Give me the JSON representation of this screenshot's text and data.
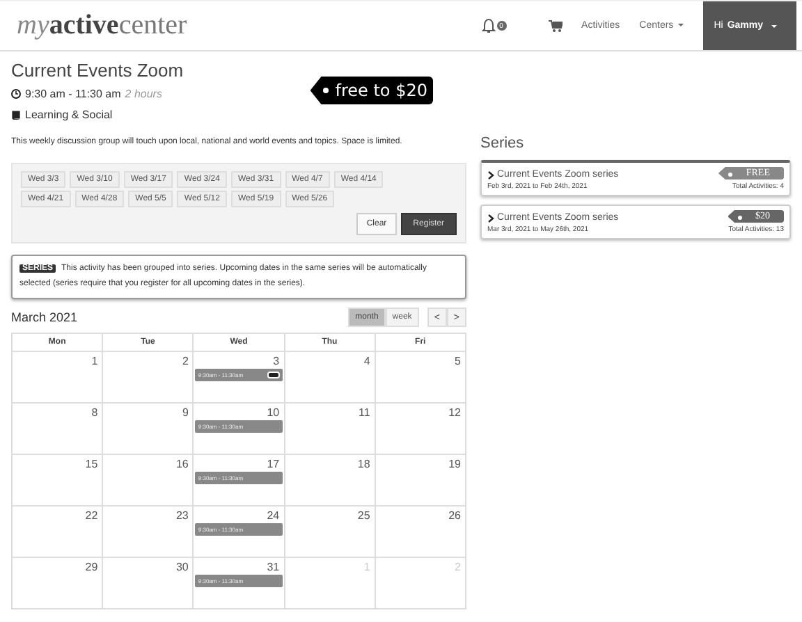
{
  "navbar": {
    "logo": {
      "script": "my",
      "bold": "active",
      "light": "center"
    },
    "notification_count": "0",
    "links": [
      "Activities",
      "Centers"
    ],
    "user": {
      "greeting": "Hi",
      "name": "Gammy"
    }
  },
  "activity": {
    "title": "Current Events Zoom",
    "time": "9:30 am - 11:30 am",
    "duration": "2 hours",
    "category": "Learning & Social",
    "description": "This weekly discussion group will touch upon local, national and world events and topics. Space is limited.",
    "price": "free to $20"
  },
  "dates": [
    "Wed 3/3",
    "Wed 3/10",
    "Wed 3/17",
    "Wed 3/24",
    "Wed 3/31",
    "Wed 4/7",
    "Wed 4/14",
    "Wed 4/21",
    "Wed 4/28",
    "Wed 5/5",
    "Wed 5/12",
    "Wed 5/19",
    "Wed 5/26"
  ],
  "buttons": [
    "Clear",
    "Register"
  ],
  "notice": {
    "tag": "SERIES",
    "text": "This activity has been grouped into series. Upcoming dates in the same series will be automatically selected (series require that you register for all upcoming dates in the series)."
  },
  "calendar": {
    "title": "March 2021",
    "views": [
      {
        "label": "month",
        "selected": true
      },
      {
        "label": "week",
        "selected": false
      }
    ],
    "prev": "<",
    "next": ">",
    "weekdays": [
      "Mon",
      "Tue",
      "Wed",
      "Thu",
      "Fri"
    ],
    "weeks": [
      [
        {
          "day": "1",
          "muted": false
        },
        {
          "day": "2",
          "muted": false
        },
        {
          "day": "3",
          "muted": false,
          "events": [
            {
              "label": "9:30am - 11:30am",
              "flagged": true
            }
          ]
        },
        {
          "day": "4",
          "muted": false
        },
        {
          "day": "5",
          "muted": false
        }
      ],
      [
        {
          "day": "8",
          "muted": false
        },
        {
          "day": "9",
          "muted": false
        },
        {
          "day": "10",
          "muted": false,
          "events": [
            {
              "label": "9:30am - 11:30am",
              "flagged": false
            }
          ]
        },
        {
          "day": "11",
          "muted": false
        },
        {
          "day": "12",
          "muted": false
        }
      ],
      [
        {
          "day": "15",
          "muted": false
        },
        {
          "day": "16",
          "muted": false
        },
        {
          "day": "17",
          "muted": false,
          "events": [
            {
              "label": "9:30am - 11:30am",
              "flagged": false
            }
          ]
        },
        {
          "day": "18",
          "muted": false
        },
        {
          "day": "19",
          "muted": false
        }
      ],
      [
        {
          "day": "22",
          "muted": false
        },
        {
          "day": "23",
          "muted": false
        },
        {
          "day": "24",
          "muted": false,
          "events": [
            {
              "label": "9:30am - 11:30am",
              "flagged": false
            }
          ]
        },
        {
          "day": "25",
          "muted": false
        },
        {
          "day": "26",
          "muted": false
        }
      ],
      [
        {
          "day": "29",
          "muted": false
        },
        {
          "day": "30",
          "muted": false
        },
        {
          "day": "31",
          "muted": false,
          "events": [
            {
              "label": "9:30am - 11:30am",
              "flagged": false
            }
          ]
        },
        {
          "day": "1",
          "muted": true
        },
        {
          "day": "2",
          "muted": true
        }
      ]
    ]
  },
  "series": {
    "heading": "Series",
    "items": [
      {
        "name": "Current Events Zoom series",
        "price": "FREE",
        "range": "Feb 3rd, 2021 to Feb 24th, 2021",
        "total": "Total Activities: 4",
        "selected": true
      },
      {
        "name": "Current Events Zoom series",
        "price": "$20",
        "range": "Mar 3rd, 2021 to May 26th, 2021",
        "total": "Total Activities: 13",
        "selected": false
      }
    ]
  }
}
